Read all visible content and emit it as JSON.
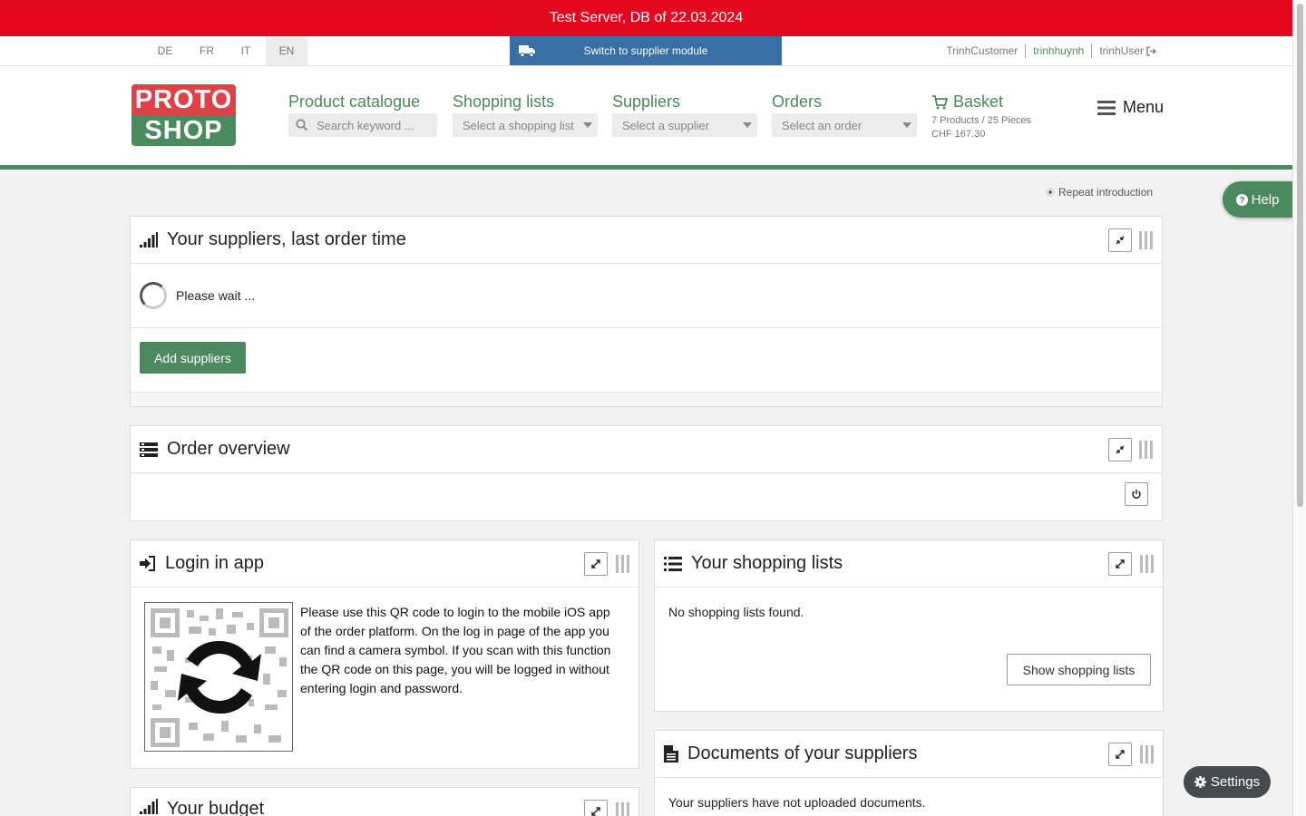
{
  "banner": {
    "text": "Test Server, DB of 22.03.2024"
  },
  "languages": [
    "DE",
    "FR",
    "IT",
    "EN"
  ],
  "active_language": "EN",
  "switch_module": {
    "label": "Switch to supplier module",
    "icon": "truck-icon"
  },
  "user_links": {
    "customer": "TrinhCustomer",
    "user_name": "trinhhuynh",
    "user": "trinhUser",
    "logout_icon": "logout-icon"
  },
  "logo": {
    "line1": "PROTO",
    "line2": "SHOP"
  },
  "nav": {
    "product_catalogue": {
      "title": "Product catalogue",
      "placeholder": "Search keyword ..."
    },
    "shopping_lists": {
      "title": "Shopping lists",
      "value": "Select a shopping list"
    },
    "suppliers": {
      "title": "Suppliers",
      "value": "Select a supplier"
    },
    "orders": {
      "title": "Orders",
      "value": "Select an order"
    },
    "basket": {
      "title": "Basket",
      "summary": "7 Products / 25 Pieces",
      "total": "CHF 167.30"
    },
    "menu": {
      "label": "Menu"
    }
  },
  "repeat_intro": "Repeat introduction",
  "help": "Help",
  "settings": "Settings",
  "panels": {
    "suppliers_last_order": {
      "title": "Your suppliers, last order time",
      "wait_text": "Please wait ...",
      "button": "Add suppliers"
    },
    "order_overview": {
      "title": "Order overview"
    },
    "login_app": {
      "title": "Login in app",
      "text": "Please use this QR code to login to the mobile iOS app of the order platform. On the log in page of the app you can find a camera symbol. If you scan with this function the QR code on this page, you will be logged in without entering login and password."
    },
    "shopping_lists": {
      "title": "Your shopping lists",
      "empty": "No shopping lists found.",
      "button": "Show shopping lists"
    },
    "documents": {
      "title": "Documents of your suppliers",
      "empty": "Your suppliers have not uploaded documents."
    },
    "budget": {
      "title": "Your budget"
    }
  },
  "colors": {
    "banner": "#e2061f",
    "brand_green": "#4b8a5e",
    "switch_blue": "#386fa4",
    "logo_red": "#e04146"
  }
}
